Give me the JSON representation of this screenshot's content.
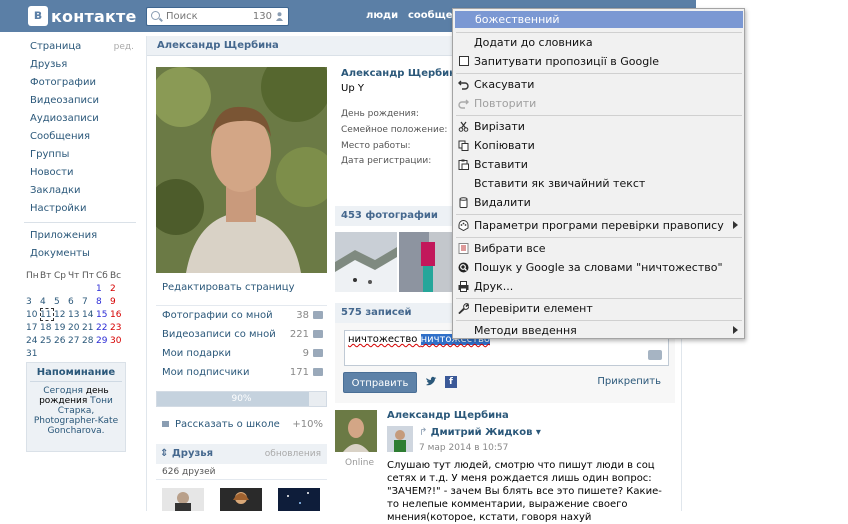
{
  "header": {
    "logo_text": "контакте",
    "logo_mark": "в",
    "search_placeholder": "Поиск",
    "search_count": "130",
    "nav_people": "люди",
    "nav_communities": "сообщест"
  },
  "sidebar": {
    "items": [
      {
        "label": "Страница",
        "extra": "ред."
      },
      {
        "label": "Друзья"
      },
      {
        "label": "Фотографии"
      },
      {
        "label": "Видеозаписи"
      },
      {
        "label": "Аудиозаписи"
      },
      {
        "label": "Сообщения"
      },
      {
        "label": "Группы"
      },
      {
        "label": "Новости"
      },
      {
        "label": "Закладки"
      },
      {
        "label": "Настройки"
      }
    ],
    "items2": [
      {
        "label": "Приложения"
      },
      {
        "label": "Документы"
      }
    ]
  },
  "calendar": {
    "days": [
      "Пн",
      "Вт",
      "Ср",
      "Чт",
      "Пт",
      "Сб",
      "Вс"
    ],
    "weeks": [
      [
        "",
        "",
        "",
        "",
        "",
        "1",
        "2"
      ],
      [
        "3",
        "4",
        "5",
        "6",
        "7",
        "8",
        "9"
      ],
      [
        "10",
        "11",
        "12",
        "13",
        "14",
        "15",
        "16"
      ],
      [
        "17",
        "18",
        "19",
        "20",
        "21",
        "22",
        "23"
      ],
      [
        "24",
        "25",
        "26",
        "27",
        "28",
        "29",
        "30"
      ],
      [
        "31",
        "",
        "",
        "",
        "",
        "",
        ""
      ]
    ],
    "today": "11"
  },
  "reminder": {
    "title": "Напоминание",
    "line1": "Сегодня",
    "line2": "день рождения",
    "person": "Тони Старка, Photographer-Kate Goncharova."
  },
  "profile": {
    "page_header": "Александр Щербина",
    "name": "Александр Щербина",
    "status": "Up Y",
    "info_labels": [
      "День рождения:",
      "Семейное положение:",
      "Место работы:",
      "Дата регистрации:"
    ],
    "edit_button": "Редактировать страницу",
    "links": [
      {
        "label": "Фотографии со мной",
        "count": "38"
      },
      {
        "label": "Видеозаписи со мной",
        "count": "221"
      },
      {
        "label": "Мои подарки",
        "count": "9"
      },
      {
        "label": "Мои подписчики",
        "count": "171"
      }
    ],
    "progress_text": "90%",
    "progress_value": 0.9,
    "school_label": "Рассказать о школе",
    "school_pct": "+10%",
    "friends_title": "Друзья",
    "friends_updates": "обновления",
    "friends_count": "626 друзей",
    "photos_header": "453 фотографии",
    "wall_header": "575 записей"
  },
  "composer": {
    "text_plain": "ничтожество ",
    "text_selected": "ничтожество",
    "send_button": "Отправить",
    "attach_label": "Прикрепить"
  },
  "post": {
    "author": "Александр Щербина",
    "online": "Online",
    "reposted_from": "Дмитрий Жидков",
    "date": "7 мар 2014 в 10:57",
    "text": "Слушаю тут людей, смотрю что пишут люди в соц сетях и т.д. У меня рождается лишь один вопрос: \"ЗАЧЕМ?!\" - зачем Вы блять все это пишете? Какие-то нелепые комментарии, выражение своего мнения(которое, кстати, говоря нахуй"
  },
  "context_menu": {
    "suggestion": "божественний",
    "add_dict": "Додати до словника",
    "check_spelling": "Запитувати пропозиції в Google",
    "undo": "Скасувати",
    "redo": "Повторити",
    "cut": "Вирізати",
    "copy": "Копіювати",
    "paste": "Вставити",
    "paste_plain": "Вставити як звичайний текст",
    "delete": "Видалити",
    "spell_options": "Параметри програми перевірки правопису",
    "select_all": "Вибрати все",
    "search_google": "Пошук у Google за словами \"ничтожество\"",
    "print": "Друк...",
    "inspect": "Перевірити елемент",
    "input_methods": "Методи введення"
  }
}
